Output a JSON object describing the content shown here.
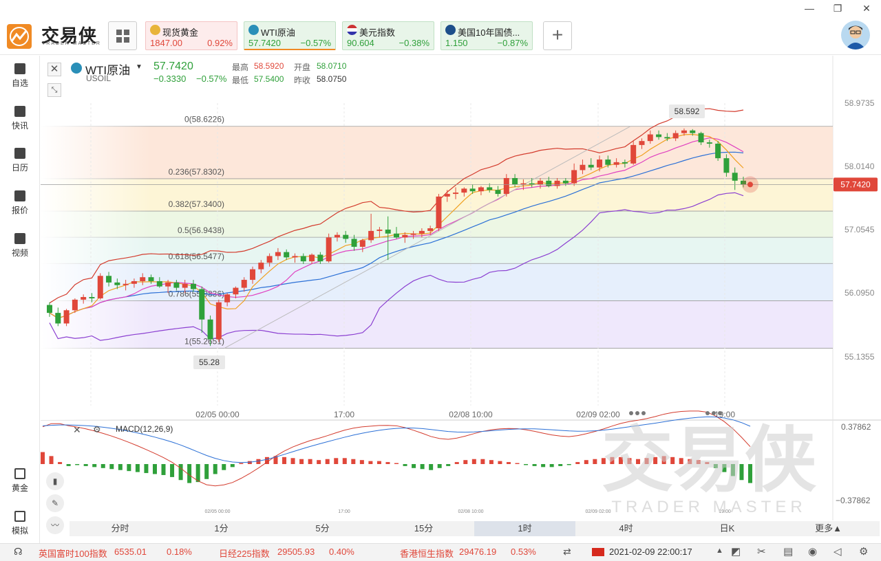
{
  "app": {
    "name_cn": "交易侠",
    "name_en": "TRADER MASTER"
  },
  "window_controls": {
    "minimize": "—",
    "restore": "❐",
    "close": "✕"
  },
  "tickers": [
    {
      "name": "现货黄金",
      "price": "1847.00",
      "change": "0.92%",
      "dir": "up",
      "icon": "gold-icon"
    },
    {
      "name": "WTI原油",
      "price": "57.7420",
      "change": "−0.57%",
      "dir": "down",
      "icon": "oil-icon"
    },
    {
      "name": "美元指数",
      "price": "90.604",
      "change": "−0.38%",
      "dir": "down",
      "icon": "us-flag-icon"
    },
    {
      "name": "美国10年国债...",
      "price": "1.150",
      "change": "−0.87%",
      "dir": "down",
      "icon": "bond-icon"
    }
  ],
  "add_tab": "+",
  "sidebar": [
    {
      "label": "自选",
      "icon": "add-watchlist-icon"
    },
    {
      "label": "快讯",
      "icon": "news-icon"
    },
    {
      "label": "日历",
      "icon": "calendar-icon"
    },
    {
      "label": "报价",
      "icon": "quote-icon"
    },
    {
      "label": "视频",
      "icon": "video-icon"
    },
    {
      "label": "黄金",
      "icon": "gold-bar-icon"
    },
    {
      "label": "模拟",
      "icon": "simulate-icon"
    }
  ],
  "instrument": {
    "name": "WTI原油",
    "code": "USOIL",
    "price": "57.7420",
    "change": "−0.3330",
    "change_pct": "−0.57%",
    "high_label": "最高",
    "high": "58.5920",
    "low_label": "最低",
    "low": "57.5400",
    "open_label": "开盘",
    "open": "58.0710",
    "prev_label": "昨收",
    "prev": "58.0750"
  },
  "colors": {
    "up": "#e0473a",
    "down": "#2fa03a",
    "accent": "#f08a24"
  },
  "chart_data": [
    {
      "type": "candlestick",
      "title": "WTI原油",
      "y_ticks": [
        "58.9735",
        "58.0140",
        "57.0545",
        "56.0950",
        "55.1355"
      ],
      "y_values": [
        58.9735,
        58.014,
        57.0545,
        56.095,
        55.1355
      ],
      "x_ticks": [
        "02/05 00:00",
        "17:00",
        "02/08 10:00",
        "02/09 02:00",
        "19:00"
      ],
      "current_price_label": "57.7420",
      "high_marker": "58.592",
      "low_marker": "55.28",
      "fibonacci": [
        {
          "label": "0(58.6226)",
          "value": 58.6226
        },
        {
          "label": "0.236(57.8302)",
          "value": 57.8302
        },
        {
          "label": "0.382(57.3400)",
          "value": 57.34
        },
        {
          "label": "0.5(56.9438)",
          "value": 56.9438
        },
        {
          "label": "0.618(56.5477)",
          "value": 56.5477
        },
        {
          "label": "0.786(55.9836)",
          "value": 55.9836
        },
        {
          "label": "1(55.2651)",
          "value": 55.2651
        }
      ],
      "candles": [
        [
          55.92,
          55.96,
          55.74,
          55.8
        ],
        [
          55.8,
          55.88,
          55.6,
          55.64
        ],
        [
          55.64,
          55.86,
          55.6,
          55.84
        ],
        [
          55.84,
          56.02,
          55.8,
          56.0
        ],
        [
          56.0,
          56.08,
          55.94,
          56.04
        ],
        [
          56.04,
          56.1,
          55.96,
          56.02
        ],
        [
          56.02,
          56.4,
          56.0,
          56.36
        ],
        [
          56.36,
          56.42,
          56.2,
          56.26
        ],
        [
          56.26,
          56.32,
          56.16,
          56.22
        ],
        [
          56.22,
          56.3,
          56.14,
          56.24
        ],
        [
          56.24,
          56.32,
          56.18,
          56.28
        ],
        [
          56.28,
          56.4,
          56.22,
          56.34
        ],
        [
          56.34,
          56.38,
          56.24,
          56.28
        ],
        [
          56.28,
          56.34,
          56.18,
          56.2
        ],
        [
          56.2,
          56.3,
          56.1,
          56.26
        ],
        [
          56.26,
          56.3,
          56.14,
          56.18
        ],
        [
          56.18,
          56.3,
          56.1,
          56.24
        ],
        [
          56.24,
          56.3,
          56.12,
          56.16
        ],
        [
          56.16,
          56.2,
          55.5,
          55.7
        ],
        [
          55.7,
          55.76,
          55.3,
          55.4
        ],
        [
          55.4,
          56.0,
          55.36,
          55.96
        ],
        [
          55.96,
          56.1,
          55.9,
          56.08
        ],
        [
          56.08,
          56.2,
          56.02,
          56.18
        ],
        [
          56.18,
          56.34,
          56.12,
          56.3
        ],
        [
          56.3,
          56.5,
          56.24,
          56.46
        ],
        [
          56.46,
          56.6,
          56.4,
          56.56
        ],
        [
          56.56,
          56.7,
          56.5,
          56.66
        ],
        [
          56.66,
          56.78,
          56.6,
          56.72
        ],
        [
          56.72,
          56.76,
          56.6,
          56.64
        ],
        [
          56.64,
          56.7,
          56.56,
          56.66
        ],
        [
          56.66,
          56.7,
          56.54,
          56.58
        ],
        [
          56.58,
          56.7,
          56.54,
          56.68
        ],
        [
          56.68,
          56.72,
          56.54,
          56.58
        ],
        [
          56.58,
          57.0,
          56.56,
          56.94
        ],
        [
          56.94,
          57.02,
          56.88,
          56.98
        ],
        [
          56.98,
          57.04,
          56.86,
          56.92
        ],
        [
          56.92,
          56.98,
          56.74,
          56.8
        ],
        [
          56.8,
          56.92,
          56.72,
          56.9
        ],
        [
          56.9,
          57.3,
          56.86,
          57.04
        ],
        [
          57.04,
          57.1,
          56.94,
          57.06
        ],
        [
          57.06,
          57.26,
          56.6,
          57.0
        ],
        [
          57.0,
          57.1,
          56.92,
          56.94
        ],
        [
          56.94,
          57.02,
          56.86,
          56.98
        ],
        [
          56.98,
          57.04,
          56.92,
          57.0
        ],
        [
          57.0,
          57.08,
          56.94,
          57.04
        ],
        [
          57.04,
          57.12,
          56.98,
          57.08
        ],
        [
          57.08,
          57.6,
          57.04,
          57.56
        ],
        [
          57.56,
          57.66,
          57.48,
          57.6
        ],
        [
          57.6,
          57.7,
          57.52,
          57.62
        ],
        [
          57.62,
          57.7,
          57.56,
          57.68
        ],
        [
          57.68,
          57.74,
          57.6,
          57.64
        ],
        [
          57.64,
          57.72,
          57.58,
          57.7
        ],
        [
          57.7,
          57.76,
          57.62,
          57.66
        ],
        [
          57.66,
          57.72,
          57.56,
          57.6
        ],
        [
          57.6,
          57.9,
          57.56,
          57.84
        ],
        [
          57.84,
          57.9,
          57.7,
          57.74
        ],
        [
          57.74,
          57.82,
          57.66,
          57.76
        ],
        [
          57.76,
          57.84,
          57.7,
          57.74
        ],
        [
          57.74,
          57.84,
          57.68,
          57.8
        ],
        [
          57.8,
          57.86,
          57.7,
          57.72
        ],
        [
          57.72,
          57.84,
          57.68,
          57.8
        ],
        [
          57.8,
          57.84,
          57.72,
          57.76
        ],
        [
          57.76,
          58.06,
          57.72,
          57.96
        ],
        [
          57.96,
          58.12,
          57.9,
          58.04
        ],
        [
          58.04,
          58.14,
          57.96,
          58.0
        ],
        [
          58.0,
          58.18,
          57.94,
          58.12
        ],
        [
          58.12,
          58.18,
          58.0,
          58.04
        ],
        [
          58.04,
          58.14,
          58.0,
          58.08
        ],
        [
          58.08,
          58.12,
          58.0,
          58.06
        ],
        [
          58.06,
          58.4,
          58.04,
          58.34
        ],
        [
          58.34,
          58.44,
          58.28,
          58.4
        ],
        [
          58.4,
          58.56,
          58.36,
          58.5
        ],
        [
          58.5,
          58.56,
          58.42,
          58.46
        ],
        [
          58.46,
          58.52,
          58.4,
          58.44
        ],
        [
          58.44,
          58.56,
          58.4,
          58.52
        ],
        [
          58.52,
          58.59,
          58.48,
          58.56
        ],
        [
          58.56,
          58.58,
          58.48,
          58.52
        ],
        [
          58.52,
          58.54,
          58.34,
          58.38
        ],
        [
          58.38,
          58.42,
          58.3,
          58.36
        ],
        [
          58.36,
          58.4,
          58.1,
          58.14
        ],
        [
          58.14,
          58.2,
          57.86,
          57.92
        ],
        [
          57.92,
          58.0,
          57.66,
          57.8
        ],
        [
          57.8,
          57.86,
          57.7,
          57.74
        ]
      ],
      "indicator": {
        "name": "MACD(12,26,9)",
        "y_ticks": [
          "0.37862",
          "−0.37862"
        ],
        "histogram": [
          0.12,
          0.08,
          0.02,
          -0.02,
          -0.01,
          -0.02,
          -0.03,
          -0.04,
          -0.05,
          -0.06,
          -0.07,
          -0.08,
          -0.09,
          -0.1,
          -0.11,
          -0.13,
          -0.16,
          -0.19,
          -0.18,
          -0.15,
          -0.1,
          -0.06,
          -0.03,
          0.01,
          0.03,
          0.05,
          0.07,
          0.08,
          0.07,
          0.06,
          0.05,
          0.05,
          0.04,
          0.05,
          0.06,
          0.06,
          0.05,
          0.04,
          0.03,
          0.03,
          0.02,
          0.01,
          -0.02,
          -0.04,
          -0.05,
          -0.06,
          -0.04,
          -0.02,
          0.02,
          0.04,
          0.05,
          0.05,
          0.04,
          0.03,
          0.02,
          0.01,
          -0.01,
          -0.02,
          -0.03,
          -0.03,
          -0.02,
          -0.01,
          0.02,
          0.04,
          0.05,
          0.06,
          0.07,
          0.07,
          0.06,
          0.05,
          0.06,
          0.07,
          0.08,
          0.07,
          0.06,
          0.05,
          0.04,
          0.02,
          -0.04,
          -0.08,
          -0.12,
          -0.16,
          -0.19
        ]
      }
    }
  ],
  "overlay_controls": [
    "candle-type-icon",
    "draw-pen-icon",
    "indicator-icon"
  ],
  "timeframes": [
    "分时",
    "1分",
    "5分",
    "15分",
    "1时",
    "4时",
    "日K",
    "更多▲"
  ],
  "active_timeframe": "1时",
  "statusbar": {
    "items": [
      {
        "name": "英国富时100指数",
        "value": "6535.01",
        "change": "0.18%"
      },
      {
        "name": "日经225指数",
        "value": "29505.93",
        "change": "0.40%"
      },
      {
        "name": "香港恒生指数",
        "value": "29476.19",
        "change": "0.53%"
      }
    ],
    "datetime": "2021-02-09 22:00:17"
  },
  "watermark": {
    "cn": "交易侠",
    "en": "TRADER MASTER"
  }
}
